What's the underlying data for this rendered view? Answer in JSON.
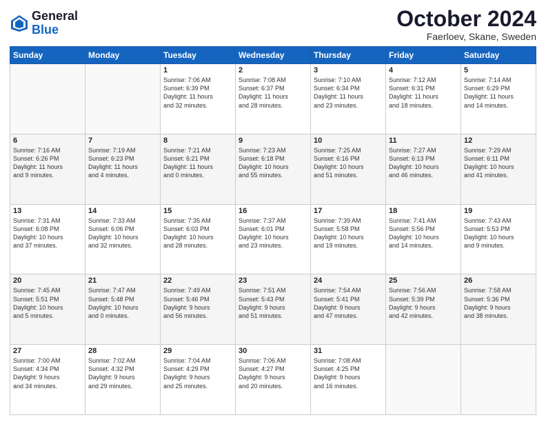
{
  "header": {
    "logo_line1": "General",
    "logo_line2": "Blue",
    "month": "October 2024",
    "location": "Faerloev, Skane, Sweden"
  },
  "weekdays": [
    "Sunday",
    "Monday",
    "Tuesday",
    "Wednesday",
    "Thursday",
    "Friday",
    "Saturday"
  ],
  "weeks": [
    [
      {
        "day": "",
        "info": ""
      },
      {
        "day": "",
        "info": ""
      },
      {
        "day": "1",
        "info": "Sunrise: 7:06 AM\nSunset: 6:39 PM\nDaylight: 11 hours\nand 32 minutes."
      },
      {
        "day": "2",
        "info": "Sunrise: 7:08 AM\nSunset: 6:37 PM\nDaylight: 11 hours\nand 28 minutes."
      },
      {
        "day": "3",
        "info": "Sunrise: 7:10 AM\nSunset: 6:34 PM\nDaylight: 11 hours\nand 23 minutes."
      },
      {
        "day": "4",
        "info": "Sunrise: 7:12 AM\nSunset: 6:31 PM\nDaylight: 11 hours\nand 18 minutes."
      },
      {
        "day": "5",
        "info": "Sunrise: 7:14 AM\nSunset: 6:29 PM\nDaylight: 11 hours\nand 14 minutes."
      }
    ],
    [
      {
        "day": "6",
        "info": "Sunrise: 7:16 AM\nSunset: 6:26 PM\nDaylight: 11 hours\nand 9 minutes."
      },
      {
        "day": "7",
        "info": "Sunrise: 7:19 AM\nSunset: 6:23 PM\nDaylight: 11 hours\nand 4 minutes."
      },
      {
        "day": "8",
        "info": "Sunrise: 7:21 AM\nSunset: 6:21 PM\nDaylight: 11 hours\nand 0 minutes."
      },
      {
        "day": "9",
        "info": "Sunrise: 7:23 AM\nSunset: 6:18 PM\nDaylight: 10 hours\nand 55 minutes."
      },
      {
        "day": "10",
        "info": "Sunrise: 7:25 AM\nSunset: 6:16 PM\nDaylight: 10 hours\nand 51 minutes."
      },
      {
        "day": "11",
        "info": "Sunrise: 7:27 AM\nSunset: 6:13 PM\nDaylight: 10 hours\nand 46 minutes."
      },
      {
        "day": "12",
        "info": "Sunrise: 7:29 AM\nSunset: 6:11 PM\nDaylight: 10 hours\nand 41 minutes."
      }
    ],
    [
      {
        "day": "13",
        "info": "Sunrise: 7:31 AM\nSunset: 6:08 PM\nDaylight: 10 hours\nand 37 minutes."
      },
      {
        "day": "14",
        "info": "Sunrise: 7:33 AM\nSunset: 6:06 PM\nDaylight: 10 hours\nand 32 minutes."
      },
      {
        "day": "15",
        "info": "Sunrise: 7:35 AM\nSunset: 6:03 PM\nDaylight: 10 hours\nand 28 minutes."
      },
      {
        "day": "16",
        "info": "Sunrise: 7:37 AM\nSunset: 6:01 PM\nDaylight: 10 hours\nand 23 minutes."
      },
      {
        "day": "17",
        "info": "Sunrise: 7:39 AM\nSunset: 5:58 PM\nDaylight: 10 hours\nand 19 minutes."
      },
      {
        "day": "18",
        "info": "Sunrise: 7:41 AM\nSunset: 5:56 PM\nDaylight: 10 hours\nand 14 minutes."
      },
      {
        "day": "19",
        "info": "Sunrise: 7:43 AM\nSunset: 5:53 PM\nDaylight: 10 hours\nand 9 minutes."
      }
    ],
    [
      {
        "day": "20",
        "info": "Sunrise: 7:45 AM\nSunset: 5:51 PM\nDaylight: 10 hours\nand 5 minutes."
      },
      {
        "day": "21",
        "info": "Sunrise: 7:47 AM\nSunset: 5:48 PM\nDaylight: 10 hours\nand 0 minutes."
      },
      {
        "day": "22",
        "info": "Sunrise: 7:49 AM\nSunset: 5:46 PM\nDaylight: 9 hours\nand 56 minutes."
      },
      {
        "day": "23",
        "info": "Sunrise: 7:51 AM\nSunset: 5:43 PM\nDaylight: 9 hours\nand 51 minutes."
      },
      {
        "day": "24",
        "info": "Sunrise: 7:54 AM\nSunset: 5:41 PM\nDaylight: 9 hours\nand 47 minutes."
      },
      {
        "day": "25",
        "info": "Sunrise: 7:56 AM\nSunset: 5:39 PM\nDaylight: 9 hours\nand 42 minutes."
      },
      {
        "day": "26",
        "info": "Sunrise: 7:58 AM\nSunset: 5:36 PM\nDaylight: 9 hours\nand 38 minutes."
      }
    ],
    [
      {
        "day": "27",
        "info": "Sunrise: 7:00 AM\nSunset: 4:34 PM\nDaylight: 9 hours\nand 34 minutes."
      },
      {
        "day": "28",
        "info": "Sunrise: 7:02 AM\nSunset: 4:32 PM\nDaylight: 9 hours\nand 29 minutes."
      },
      {
        "day": "29",
        "info": "Sunrise: 7:04 AM\nSunset: 4:29 PM\nDaylight: 9 hours\nand 25 minutes."
      },
      {
        "day": "30",
        "info": "Sunrise: 7:06 AM\nSunset: 4:27 PM\nDaylight: 9 hours\nand 20 minutes."
      },
      {
        "day": "31",
        "info": "Sunrise: 7:08 AM\nSunset: 4:25 PM\nDaylight: 9 hours\nand 16 minutes."
      },
      {
        "day": "",
        "info": ""
      },
      {
        "day": "",
        "info": ""
      }
    ]
  ]
}
